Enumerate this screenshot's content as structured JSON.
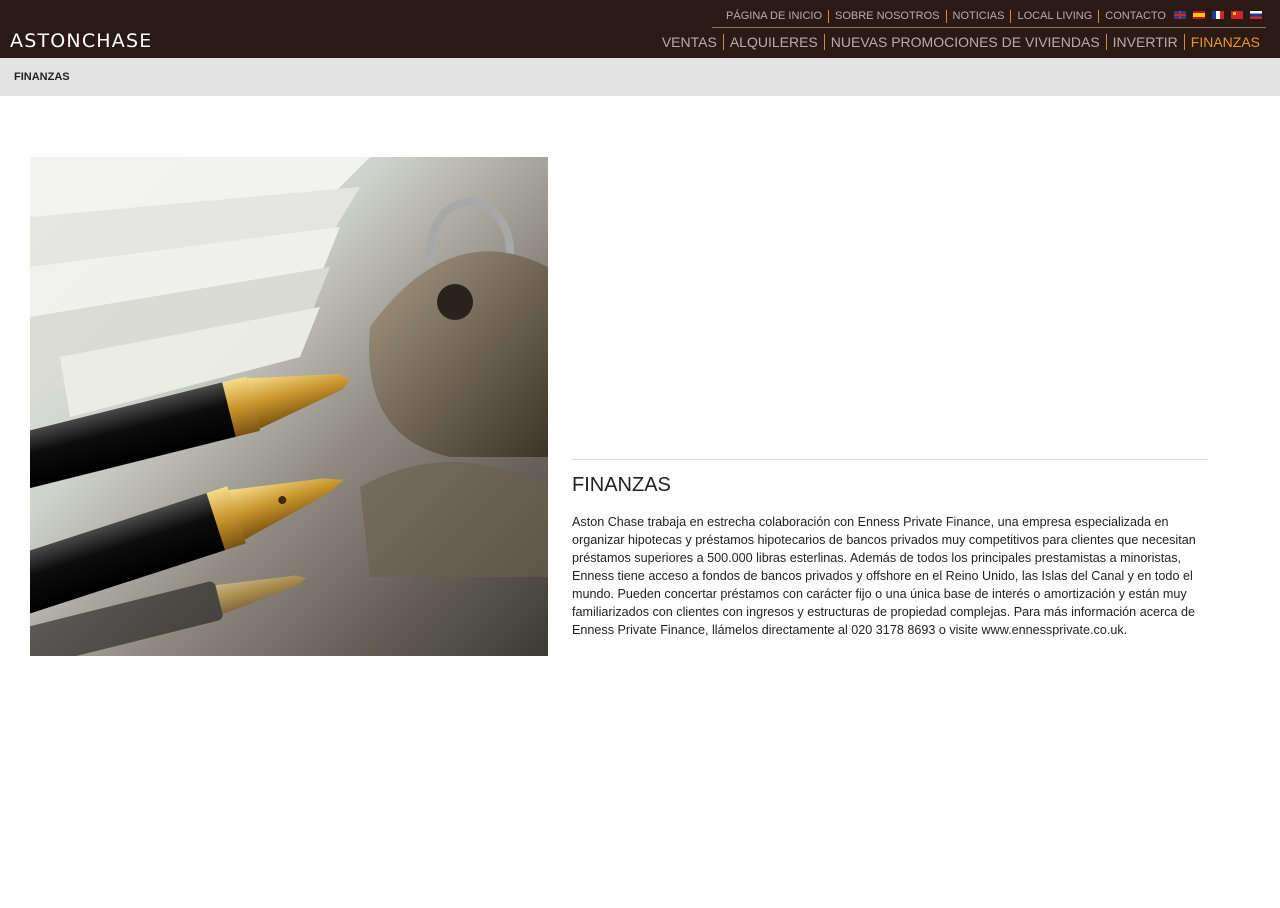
{
  "header": {
    "logo": "ASTONCHASE",
    "top_nav": [
      "PÁGINA DE INICIO",
      "SOBRE NOSOTROS",
      "NOTICIAS",
      "LOCAL LIVING",
      "CONTACTO"
    ],
    "languages": [
      "uk-flag-icon",
      "spain-flag-icon",
      "france-flag-icon",
      "china-flag-icon",
      "russia-flag-icon"
    ],
    "main_nav": [
      "VENTAS",
      "ALQUILERES",
      "NUEVAS PROMOCIONES DE VIVIENDAS",
      "INVERTIR",
      "FINANZAS"
    ],
    "active_nav": "FINANZAS"
  },
  "colors": {
    "header_bg": "#2b1a13",
    "accent": "#e8952a",
    "nav_text": "#b7aca6",
    "breadcrumb_bg": "#e3e3e3"
  },
  "breadcrumb": "FINANZAS",
  "main": {
    "image": "pens-and-keys-photo",
    "title": "FINANZAS",
    "body": "Aston Chase trabaja en estrecha colaboración con Enness Private Finance, una empresa especializada en organizar hipotecas y préstamos hipotecarios de bancos privados muy competitivos para clientes que necesitan préstamos superiores a 500.000 libras esterlinas. Además de todos los principales prestamistas a minoristas, Enness tiene acceso a fondos de bancos privados y offshore en el Reino Unido, las Islas del Canal y en todo el mundo. Pueden concertar préstamos con carácter fijo o una única base de interés o amortización y están muy familiarizados con clientes con ingresos y estructuras de propiedad complejas. Para más información acerca de Enness Private Finance, llámelos directamente al 020 3178 8693 o visite www.ennessprivate.co.uk."
  }
}
